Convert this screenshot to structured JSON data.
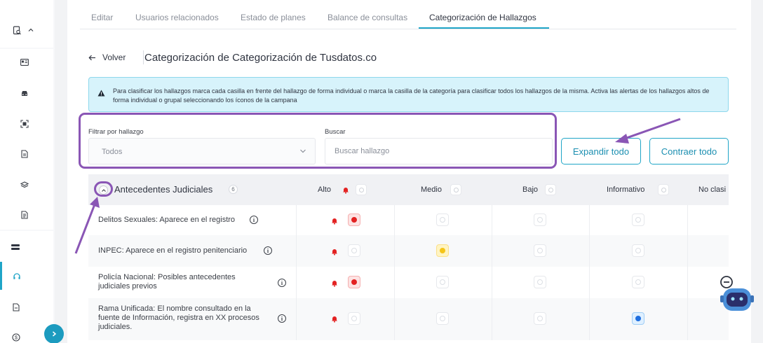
{
  "tabs": [
    {
      "label": "Editar"
    },
    {
      "label": "Usuarios relacionados"
    },
    {
      "label": "Estado de planes"
    },
    {
      "label": "Balance de consultas"
    },
    {
      "label": "Categorización de Hallazgos"
    }
  ],
  "active_tab": 4,
  "header": {
    "back_label": "Volver",
    "title": "Categorización de Categorización de Tusdatos.co"
  },
  "alert": {
    "text": "Para clasificar los hallazgos marca cada casilla en frente del hallazgo de forma individual o marca la casilla de la categoría para clasificar todos los hallazgos de la misma. Activa las alertas de los hallazgos altos de forma individual o grupal seleccionando los íconos de la campana"
  },
  "filters": {
    "filter_label": "Filtrar por hallazgo",
    "filter_value": "Todos",
    "search_label": "Buscar",
    "search_placeholder": "Buscar hallazgo",
    "search_value": ""
  },
  "buttons": {
    "expand_all": "Expandir todo",
    "collapse_all": "Contraer todo"
  },
  "table": {
    "group_title": "Antecedentes Judiciales",
    "group_count": "6",
    "columns": [
      "Alto",
      "Medio",
      "Bajo",
      "Informativo",
      "No clasi"
    ],
    "rows": [
      {
        "label": "Delitos Sexuales: Aparece en el registro",
        "selected": "Alto"
      },
      {
        "label": "INPEC: Aparece en el registro penitenciario",
        "selected": "Medio"
      },
      {
        "label": "Policía Nacional: Posibles antecedentes judiciales previos",
        "selected": "Alto"
      },
      {
        "label": "Rama Unificada: El nombre consultado en la fuente de Información, registra en XX procesos judiciales.",
        "selected": "Informativo"
      }
    ]
  },
  "colors": {
    "accent": "#1fa5c7",
    "annotation": "#8a56b5",
    "alto": "#e32222",
    "medio": "#f5c518",
    "informativo": "#1f6fe0"
  }
}
